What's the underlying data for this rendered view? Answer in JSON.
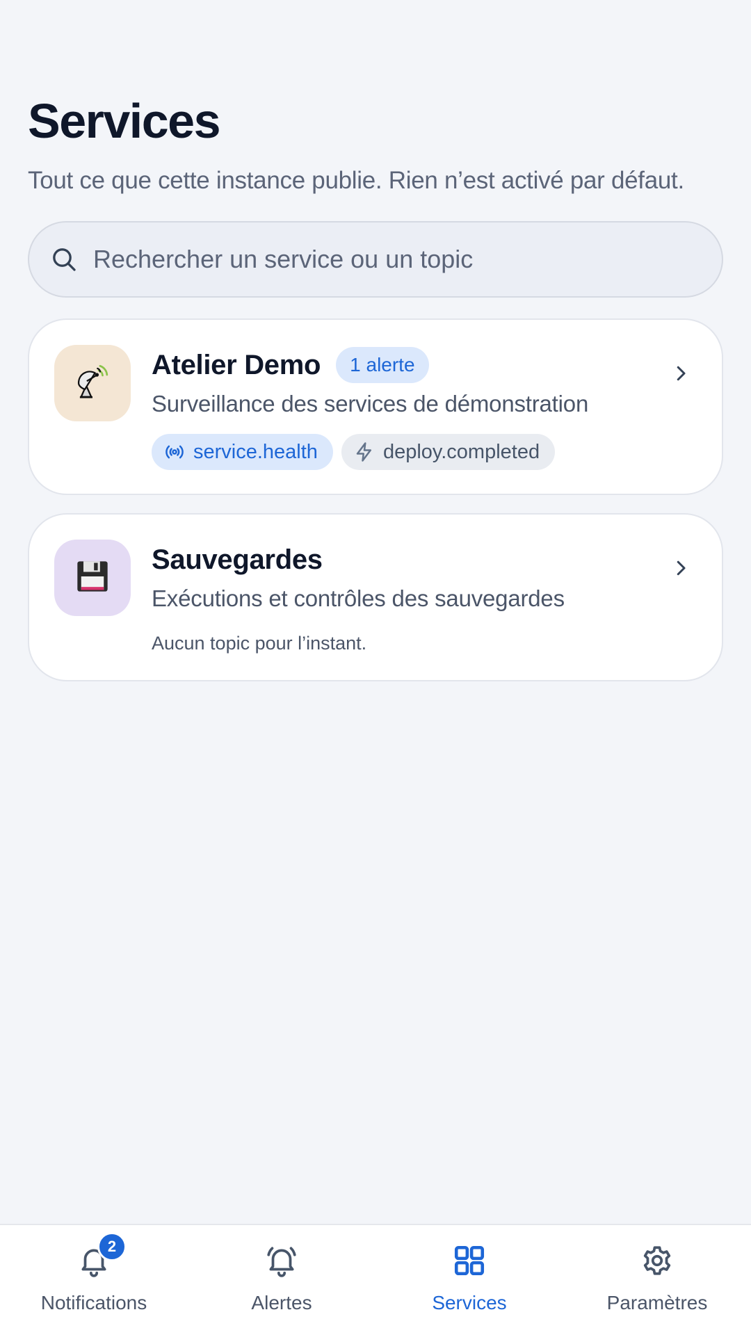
{
  "header": {
    "title": "Services",
    "subtitle": "Tout ce que cette instance publie. Rien n’est activé par défaut."
  },
  "search": {
    "placeholder": "Rechercher un service ou un topic",
    "icon": "search-icon"
  },
  "services": [
    {
      "name": "Atelier Demo",
      "badge": "1 alerte",
      "description": "Surveillance des services de démonstration",
      "icon": "satellite-antenna-icon",
      "icon_bg": "#f4e6d4",
      "topics": [
        {
          "label": "service.health",
          "icon": "broadcast-icon",
          "style": "blue"
        },
        {
          "label": "deploy.completed",
          "icon": "lightning-icon",
          "style": "gray"
        }
      ]
    },
    {
      "name": "Sauvegardes",
      "description": "Exécutions et contrôles des sauvegardes",
      "icon": "floppy-disk-icon",
      "icon_bg": "#e4dbf4",
      "empty_topics": "Aucun topic pour l’instant."
    }
  ],
  "tabbar": {
    "tabs": [
      {
        "label": "Notifications",
        "icon": "bell-icon",
        "badge": "2",
        "active": false
      },
      {
        "label": "Alertes",
        "icon": "bell-ringing-icon",
        "active": false
      },
      {
        "label": "Services",
        "icon": "grid-icon",
        "active": true
      },
      {
        "label": "Paramètres",
        "icon": "gear-icon",
        "active": false
      }
    ]
  },
  "colors": {
    "accent": "#1d66d6",
    "background": "#f3f5f9",
    "card": "#ffffff",
    "text_primary": "#0f172a",
    "text_secondary": "#4b5568"
  }
}
